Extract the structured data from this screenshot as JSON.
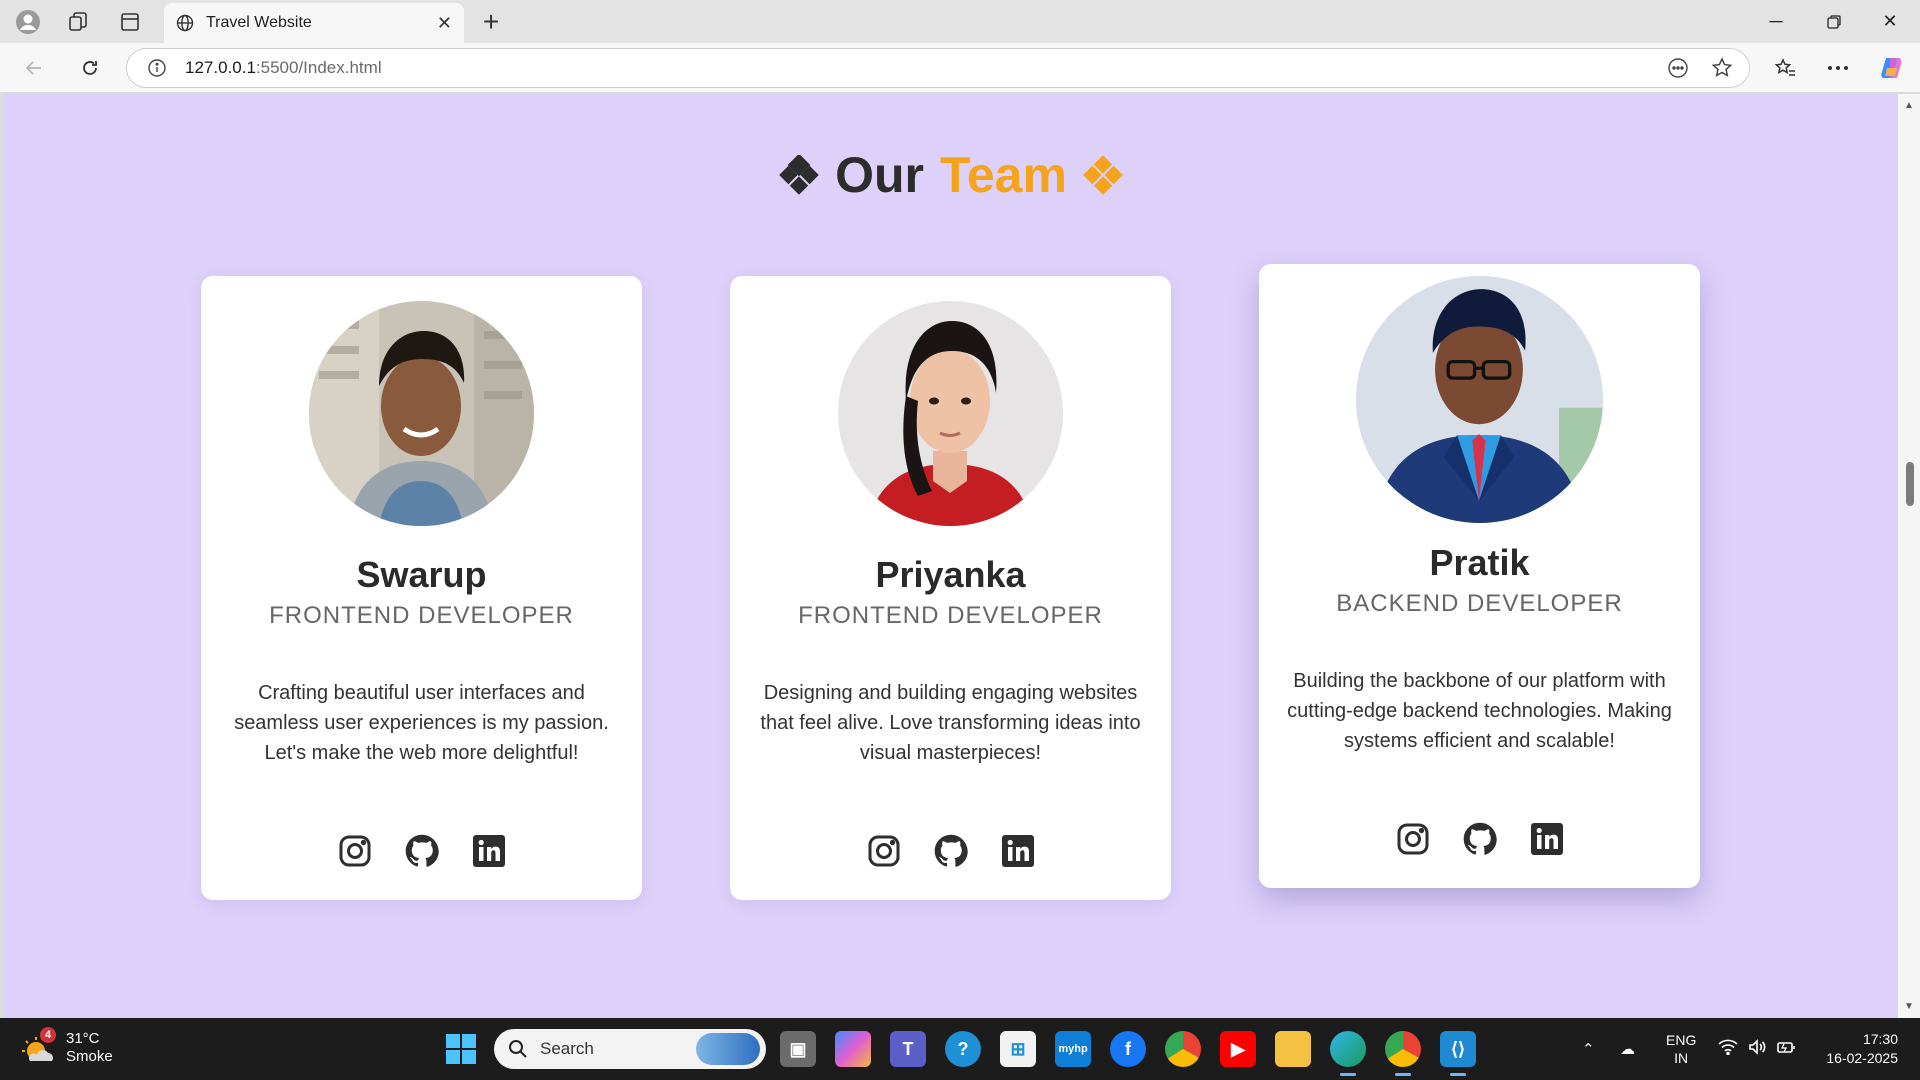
{
  "browser": {
    "tab_title": "Travel Website",
    "url_host": "127.0.0.1",
    "url_rest": ":5500/Index.html"
  },
  "page": {
    "title_part1": "Our",
    "title_part2": "Team",
    "accent_color": "#f5a31a",
    "background_color": "#ddd1fa"
  },
  "team": [
    {
      "name": "Swarup",
      "role": "FRONTEND DEVELOPER",
      "bio": "Crafting beautiful user interfaces and seamless user experiences is my passion. Let's make the web more delightful!",
      "socials": [
        "instagram-icon",
        "github-icon",
        "linkedin-icon"
      ]
    },
    {
      "name": "Priyanka",
      "role": "FRONTEND DEVELOPER",
      "bio": "Designing and building engaging websites that feel alive. Love transforming ideas into visual masterpieces!",
      "socials": [
        "instagram-icon",
        "github-icon",
        "linkedin-icon"
      ]
    },
    {
      "name": "Pratik",
      "role": "BACKEND DEVELOPER",
      "bio": "Building the backbone of our platform with cutting-edge backend technologies. Making systems efficient and scalable!",
      "socials": [
        "instagram-icon",
        "github-icon",
        "linkedin-icon"
      ]
    }
  ],
  "taskbar": {
    "weather_temp": "31°C",
    "weather_desc": "Smoke",
    "weather_badge": "4",
    "search_label": "Search",
    "lang_line1": "ENG",
    "lang_line2": "IN",
    "time": "17:30",
    "date": "16-02-2025"
  }
}
